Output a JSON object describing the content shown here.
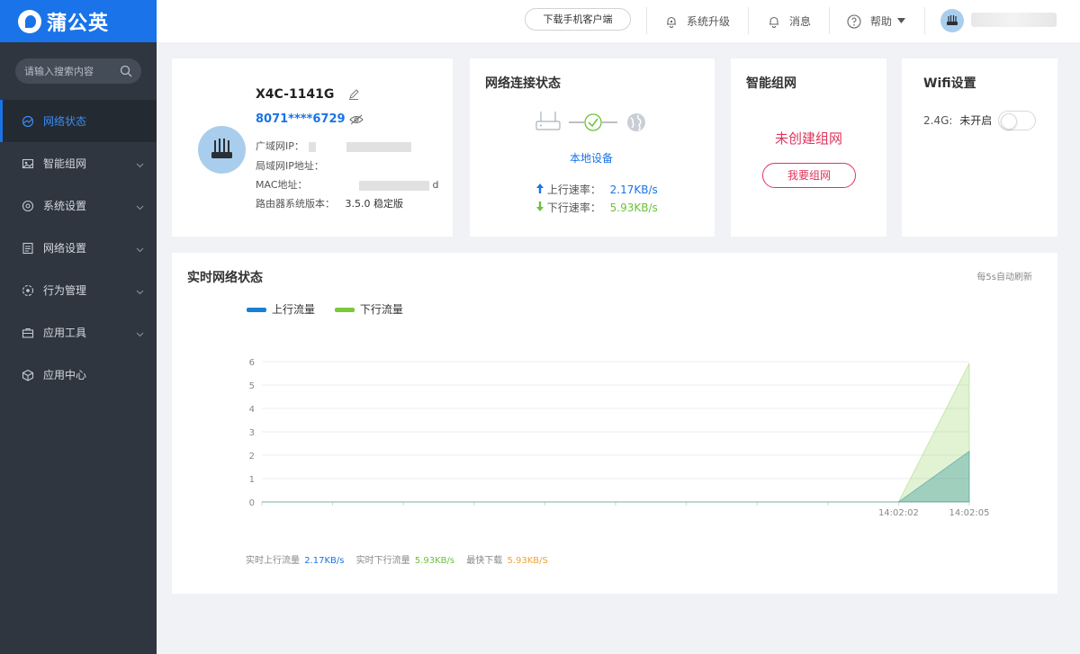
{
  "brand": {
    "name": "蒲公英"
  },
  "search": {
    "placeholder": "请输入搜索内容"
  },
  "sidebar": {
    "items": [
      {
        "label": "网络状态",
        "icon": "network-status-icon",
        "active": true
      },
      {
        "label": "智能组网",
        "icon": "mesh-icon"
      },
      {
        "label": "系统设置",
        "icon": "gear-icon"
      },
      {
        "label": "网络设置",
        "icon": "document-icon"
      },
      {
        "label": "行为管理",
        "icon": "behavior-icon"
      },
      {
        "label": "应用工具",
        "icon": "toolbox-icon"
      },
      {
        "label": "应用中心",
        "icon": "cube-icon"
      }
    ]
  },
  "header": {
    "download_label": "下载手机客户端",
    "upgrade_label": "系统升级",
    "message_label": "消息",
    "help_label": "帮助"
  },
  "device": {
    "name": "X4C-1141G",
    "sn": "8071****6729",
    "wan_label": "广域网IP：",
    "lan_label": "局域网IP地址：",
    "mac_label": "MAC地址：",
    "mac_tail": "d",
    "version_label": "路由器系统版本：",
    "version": "3.5.0 稳定版"
  },
  "connection": {
    "title": "网络连接状态",
    "local_device": "本地设备",
    "up_label": "上行速率：",
    "up_value": "2.17KB/s",
    "down_label": "下行速率：",
    "down_value": "5.93KB/s"
  },
  "mesh": {
    "title": "智能组网",
    "status": "未创建组网",
    "button": "我要组网"
  },
  "wifi": {
    "title": "Wifi设置",
    "band_label": "2.4G:",
    "band_status": "未开启",
    "enabled": false
  },
  "realtime": {
    "title": "实时网络状态",
    "refresh_note": "每5s自动刷新",
    "up_stat_label": "实时上行流量",
    "up_stat_value": "2.17KB/s",
    "down_stat_label": "实时下行流量",
    "down_stat_value": "5.93KB/s",
    "max_label": "最快下载",
    "max_value": "5.93KB/S"
  },
  "colors": {
    "accent": "#1a73e8",
    "up_series": "#1a7fd4",
    "down_series": "#7cc73a",
    "mesh_red": "#e0335a",
    "sidebar_bg": "#2f3640",
    "max_value": "#f2a23a"
  },
  "chart_data": {
    "type": "area",
    "x": [
      "",
      "",
      "",
      "",
      "",
      "",
      "",
      "",
      "",
      "14:02:02",
      "14:02:05"
    ],
    "series": [
      {
        "name": "上行流量",
        "values": [
          0,
          0,
          0,
          0,
          0,
          0,
          0,
          0,
          0,
          0,
          2.17
        ]
      },
      {
        "name": "下行流量",
        "values": [
          0,
          0,
          0,
          0,
          0,
          0,
          0,
          0,
          0,
          0,
          5.93
        ]
      }
    ],
    "yticks": [
      0,
      1,
      2,
      3,
      4,
      5,
      6
    ],
    "ylim": [
      0,
      6
    ],
    "legend": "top-left",
    "grid": true
  }
}
